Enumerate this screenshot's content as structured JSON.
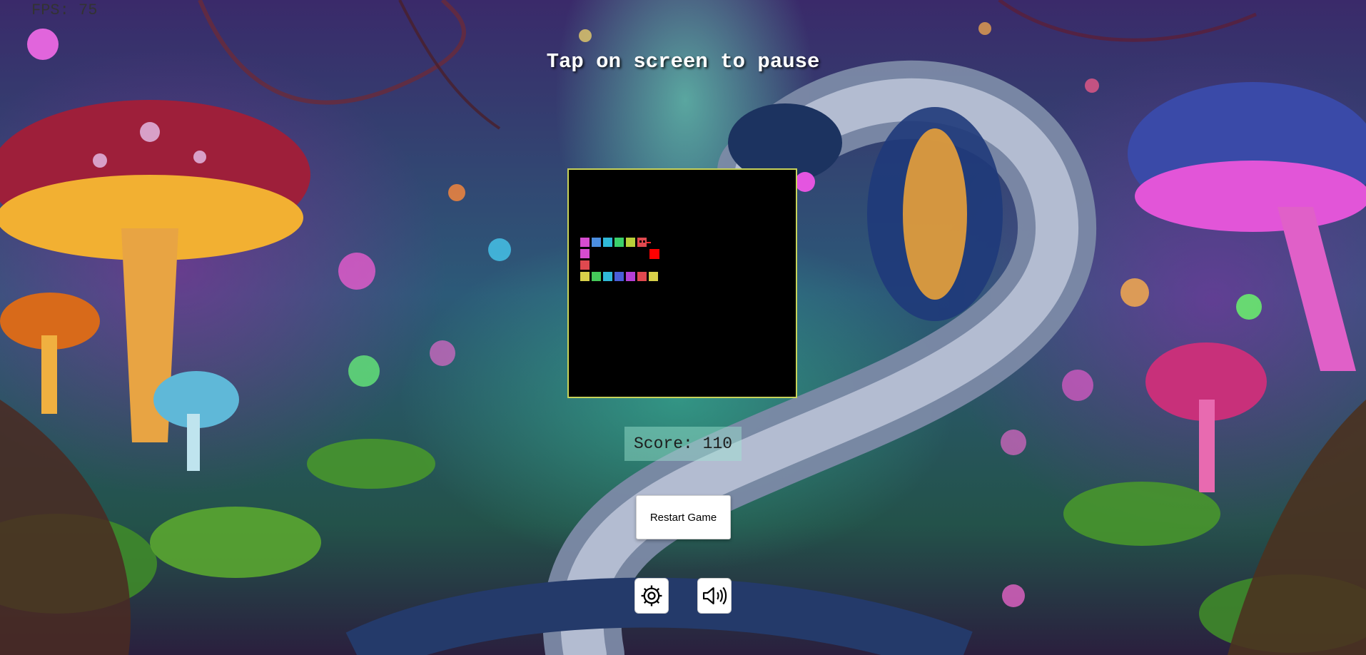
{
  "hud": {
    "fps_text": "FPS: 75",
    "pause_hint": "Tap on screen to pause"
  },
  "score": {
    "text": "Score: 110"
  },
  "controls": {
    "restart_label": "Restart Game",
    "settings_icon": "gear-icon",
    "sound_icon": "speaker-icon"
  },
  "colors": {
    "board_background": "#000000",
    "board_border": "#c8d35a",
    "food": "#ff0000",
    "snake_head": "#e0494f"
  },
  "snake": {
    "segment_colors": [
      "#d64cd0",
      "#4c8ee0",
      "#2fb9d8",
      "#3bd06a",
      "#b8d03a",
      "#e0494f",
      "#d64cd0",
      "#e0494f",
      "#d8d04a",
      "#45c95a",
      "#2fb9d8",
      "#4a5ed8",
      "#b63fd6",
      "#e0494f",
      "#d8d04a"
    ]
  }
}
